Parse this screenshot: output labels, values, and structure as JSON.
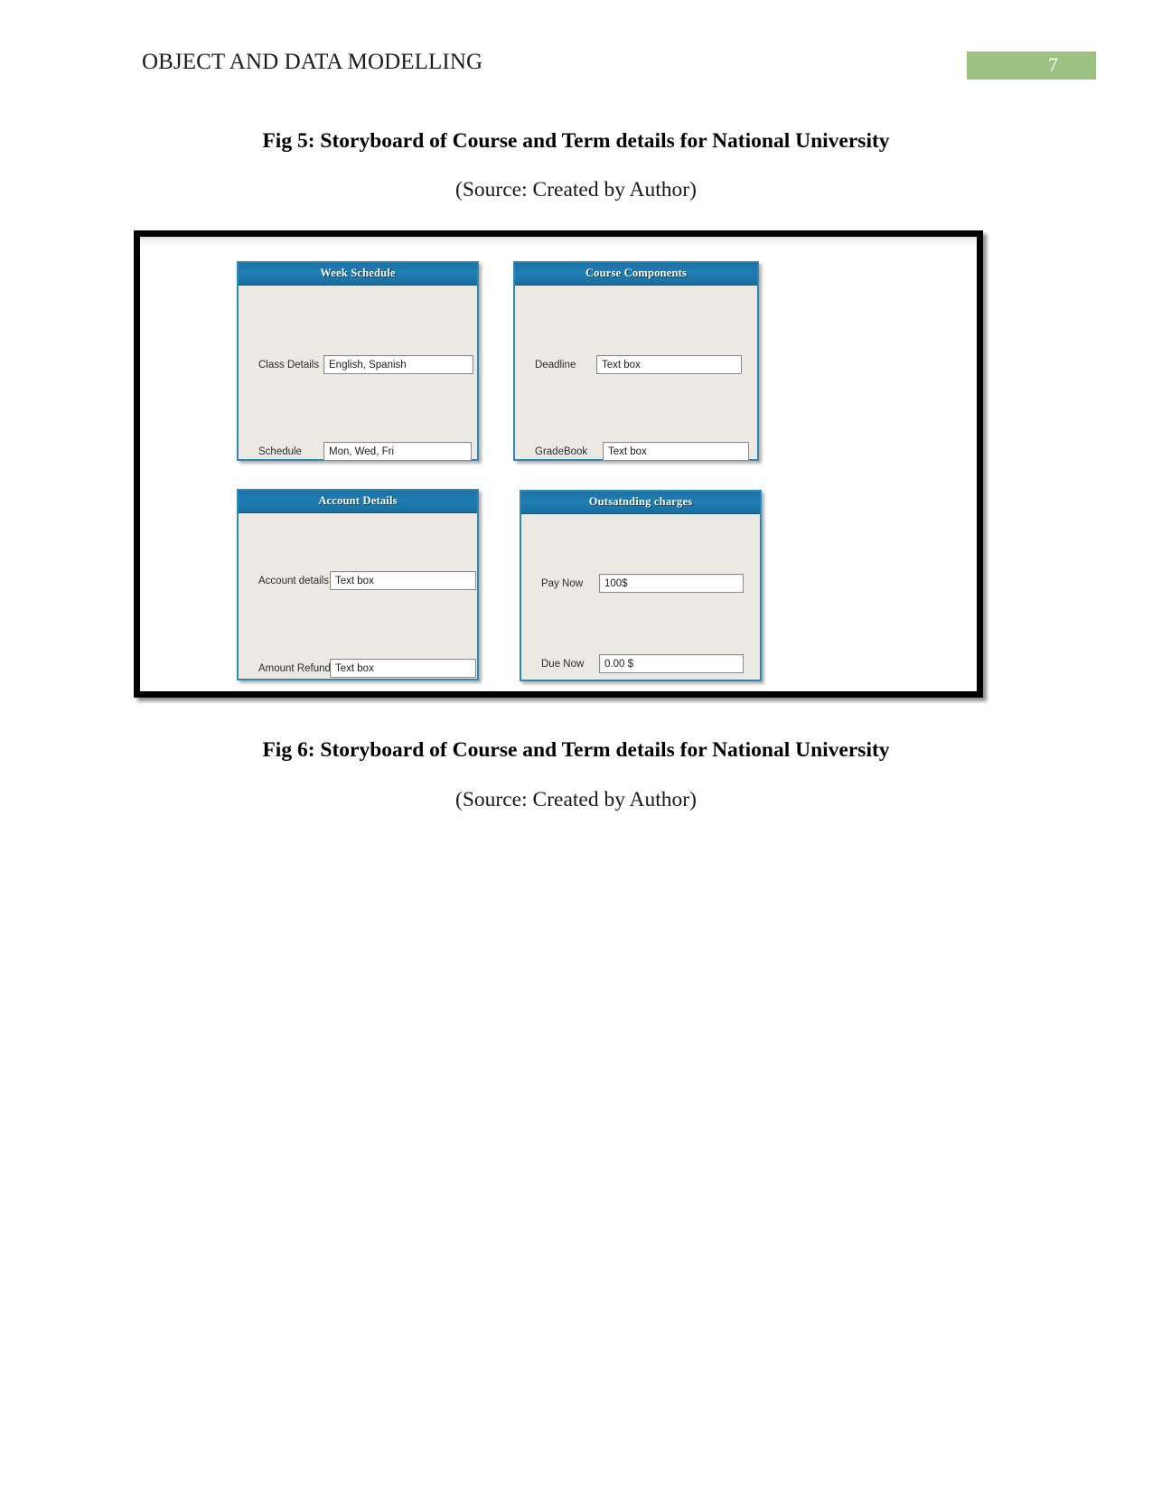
{
  "header": {
    "title": "OBJECT AND DATA MODELLING",
    "page_number": "7",
    "badge_color": "#9bc183"
  },
  "captions": {
    "fig5_title": "Fig 5: Storyboard of Course and Term details for National University",
    "fig5_source": "(Source: Created by Author)",
    "fig6_title": "Fig 6: Storyboard of Course and Term details for National University",
    "fig6_source": "(Source: Created by Author)"
  },
  "storyboard": {
    "titlebar_color": "#1e7fb4",
    "panel_border_color": "#2b88b8",
    "panel_background": "#ece9e3",
    "panels": [
      {
        "title": "Week Schedule",
        "fields": [
          {
            "label": "Class Details",
            "value": "English, Spanish"
          },
          {
            "label": "Schedule",
            "value": "Mon, Wed, Fri"
          }
        ]
      },
      {
        "title": "Course Components",
        "fields": [
          {
            "label": "Deadline",
            "value": "Text box"
          },
          {
            "label": "GradeBook",
            "value": "Text box"
          }
        ]
      },
      {
        "title": "Account Details",
        "fields": [
          {
            "label": "Account details",
            "value": "Text box"
          },
          {
            "label": "Amount Refund",
            "value": "Text box"
          }
        ]
      },
      {
        "title": "Outsatnding charges",
        "fields": [
          {
            "label": "Pay Now",
            "value": "100$"
          },
          {
            "label": "Due Now",
            "value": "0.00 $"
          }
        ]
      }
    ]
  }
}
